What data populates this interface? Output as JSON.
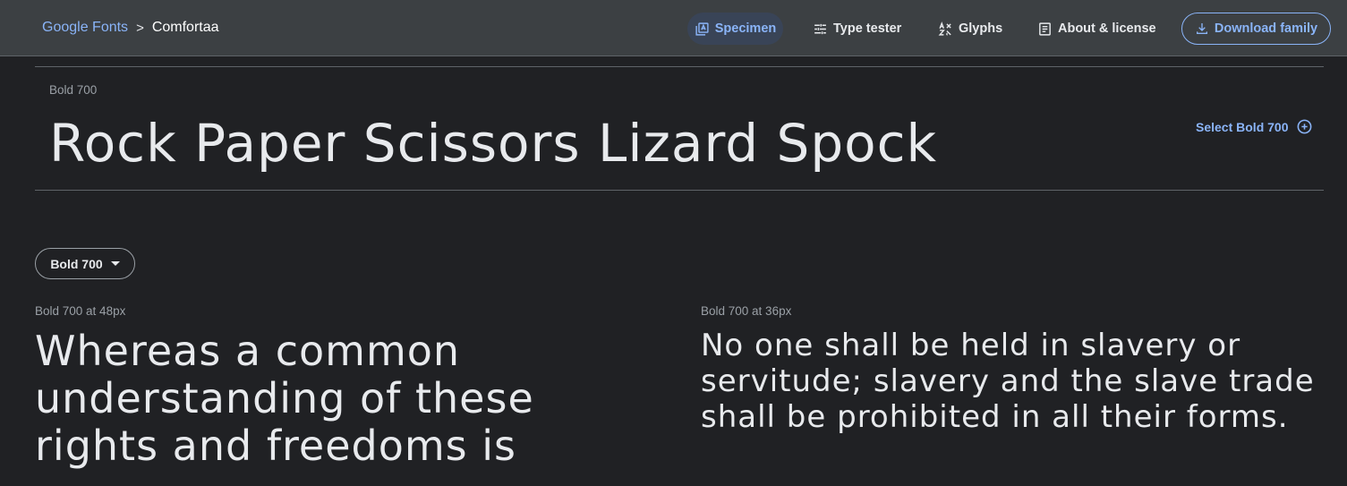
{
  "breadcrumb": {
    "root": "Google Fonts",
    "separator": ">",
    "current": "Comfortaa"
  },
  "nav": {
    "specimen": "Specimen",
    "type_tester": "Type tester",
    "glyphs": "Glyphs",
    "about": "About & license",
    "download": "Download family"
  },
  "hero": {
    "style_label": "Bold 700",
    "sample_text": "Rock Paper Scissors Lizard Spock",
    "select_label": "Select Bold 700"
  },
  "weight_selector": {
    "value": "Bold 700"
  },
  "samples": [
    {
      "label": "Bold 700 at 48px",
      "text": "Whereas a common understanding of these rights and freedoms is"
    },
    {
      "label": "Bold 700 at 36px",
      "text": "No one shall be held in slavery or servitude; slavery and the slave trade shall be prohibited in all their forms."
    }
  ],
  "colors": {
    "accent": "#8ab4f8",
    "background": "#202124",
    "topbar": "#3c4043",
    "text": "#e8eaed"
  },
  "icons": [
    "specimen-icon",
    "tune-icon",
    "glyphs-icon",
    "article-icon",
    "download-icon",
    "add-circle-icon",
    "caret-down-icon"
  ]
}
